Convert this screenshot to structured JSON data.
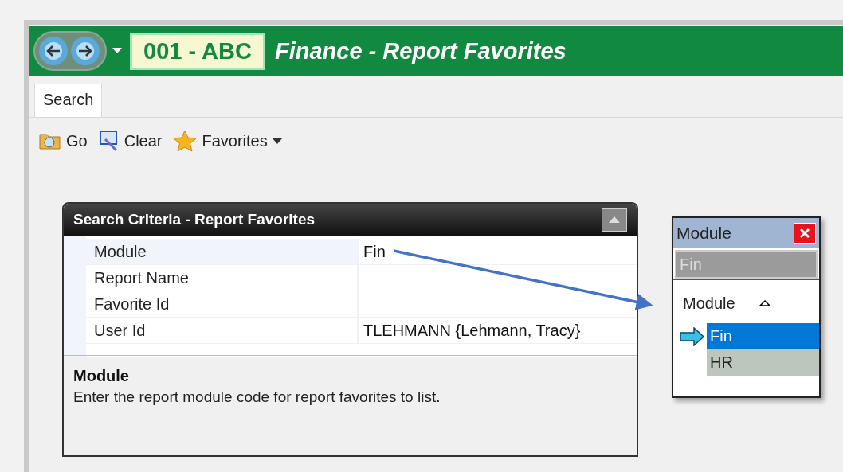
{
  "header": {
    "code": "001 - ABC",
    "title": "Finance - Report Favorites"
  },
  "tabs": [
    {
      "label": "Search",
      "selected": true
    }
  ],
  "toolbar": [
    {
      "label": "Go",
      "kind": "go"
    },
    {
      "label": "Clear",
      "kind": "clear"
    },
    {
      "label": "Favorites",
      "kind": "menu"
    }
  ],
  "criteria": {
    "title": "Search Criteria - Report Favorites",
    "rows": [
      {
        "label": "Module",
        "value": "Fin",
        "selected": true
      },
      {
        "label": "Report Name",
        "selected": false
      },
      {
        "label": "Favorite Id",
        "selected": false
      },
      {
        "label": "User Id",
        "value": "TLEHMANN {Lehmann, Tracy}",
        "selected": false
      }
    ],
    "help": {
      "title": "Module",
      "text": "Enter the report module code for report favorites to list."
    }
  },
  "lookup": {
    "title": "Module",
    "search": "Fin",
    "column": "Module",
    "items": [
      {
        "label": "Fin",
        "selected": true
      },
      {
        "label": "HR",
        "selected": false
      }
    ]
  }
}
